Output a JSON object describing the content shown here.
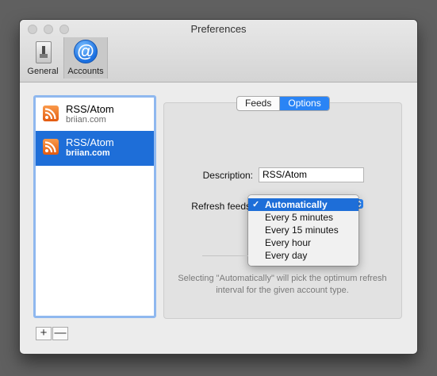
{
  "window": {
    "title": "Preferences"
  },
  "toolbar": {
    "general_label": "General",
    "accounts_label": "Accounts",
    "accounts_icon_glyph": "@"
  },
  "accounts": [
    {
      "name": "RSS/Atom",
      "host": "briian.com",
      "selected": false
    },
    {
      "name": "RSS/Atom",
      "host": "briian.com",
      "selected": true
    }
  ],
  "list_controls": {
    "add": "+",
    "remove": "—"
  },
  "tabs": [
    {
      "label": "Feeds",
      "active": false
    },
    {
      "label": "Options",
      "active": true
    }
  ],
  "form": {
    "description_label": "Description:",
    "description_value": "RSS/Atom",
    "refresh_label": "Refresh feeds"
  },
  "refresh_menu": {
    "selected_check": "✓",
    "options": [
      "Automatically",
      "Every 5 minutes",
      "Every 15 minutes",
      "Every hour",
      "Every day"
    ]
  },
  "hint_text": "Selecting \"Automatically\" will pick the optimum refresh interval for the given account type.",
  "colors": {
    "accent": "#1e6ed8",
    "rss_orange": "#e8651a"
  }
}
